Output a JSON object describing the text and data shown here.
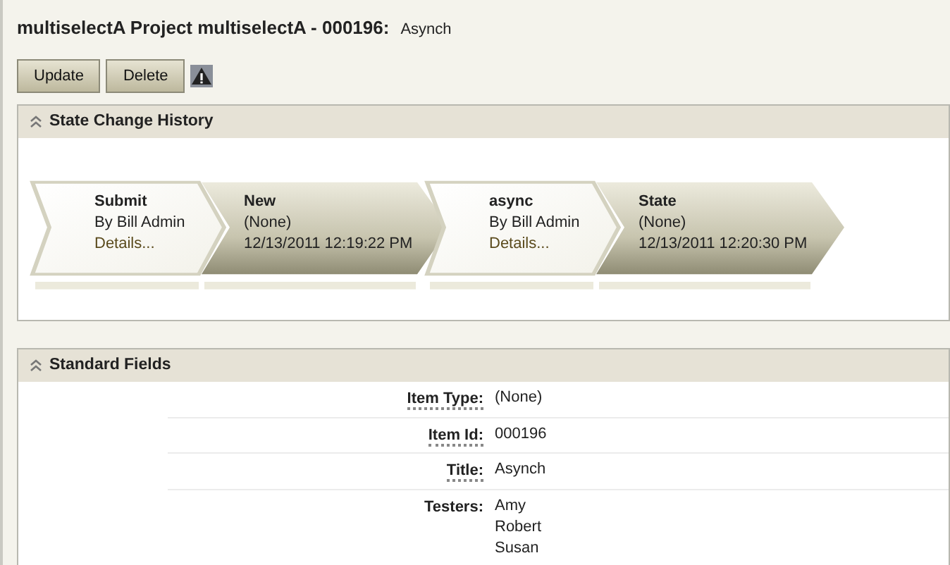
{
  "header": {
    "title": "multiselectA Project multiselectA - 000196:",
    "subtitle": "Asynch"
  },
  "buttons": [
    "Update",
    "Delete"
  ],
  "history": {
    "heading": "State Change History",
    "expanded": true,
    "steps": [
      {
        "kind": "transition",
        "name": "Submit",
        "line": "By Bill Admin",
        "link": "Details..."
      },
      {
        "kind": "state",
        "name": "New",
        "line": "(None)",
        "time": "12/13/2011 12:19:22 PM"
      },
      {
        "kind": "transition",
        "name": "async",
        "line": "By Bill Admin",
        "link": "Details..."
      },
      {
        "kind": "state",
        "name": "State",
        "line": "(None)",
        "time": "12/13/2011 12:20:30 PM"
      }
    ]
  },
  "fields": {
    "heading": "Standard Fields",
    "expanded": true,
    "rows": [
      {
        "label": "Item Type:",
        "help": true,
        "values": [
          "(None)"
        ]
      },
      {
        "label": "Item Id:",
        "help": true,
        "values": [
          "000196"
        ]
      },
      {
        "label": "Title:",
        "help": true,
        "values": [
          "Asynch"
        ]
      },
      {
        "label": "Testers:",
        "help": false,
        "values": [
          "Amy",
          "Robert",
          "Susan"
        ]
      }
    ]
  }
}
